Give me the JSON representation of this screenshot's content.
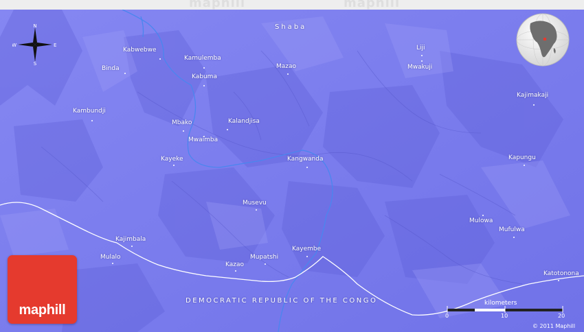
{
  "topbar": {
    "watermark": "maphill"
  },
  "map": {
    "colors": {
      "land": "#7a7cee",
      "river": "#4a86ef",
      "road": "#ffffff",
      "logo": "#e53a2e"
    },
    "compass": {
      "north": "N",
      "south": "S",
      "east": "E",
      "west": "W"
    },
    "regions": {
      "province": "Shaba",
      "country": "DEMOCRATIC REPUBLIC OF THE CONGO"
    },
    "places": [
      {
        "name": "Kabwebwe"
      },
      {
        "name": "Kamulemba"
      },
      {
        "name": "Binda"
      },
      {
        "name": "Kabuma"
      },
      {
        "name": "Mazao"
      },
      {
        "name": "Liji"
      },
      {
        "name": "Mwakuji"
      },
      {
        "name": "Kajimakaji"
      },
      {
        "name": "Kambundji"
      },
      {
        "name": "Mbako"
      },
      {
        "name": "Kalandjisa"
      },
      {
        "name": "Mwaimba"
      },
      {
        "name": "Kayeke"
      },
      {
        "name": "Kangwanda"
      },
      {
        "name": "Kapungu"
      },
      {
        "name": "Musevu"
      },
      {
        "name": "Mulowa"
      },
      {
        "name": "Mufulwa"
      },
      {
        "name": "Kajimbala"
      },
      {
        "name": "Mulalo"
      },
      {
        "name": "Kayembe"
      },
      {
        "name": "Mupatshi"
      },
      {
        "name": "Kazao"
      },
      {
        "name": "Katotonona"
      }
    ],
    "scale": {
      "title": "kilometers",
      "ticks": [
        "0",
        "10",
        "20"
      ]
    },
    "logo": "maphill",
    "copyright": "© 2011 Maphill"
  }
}
